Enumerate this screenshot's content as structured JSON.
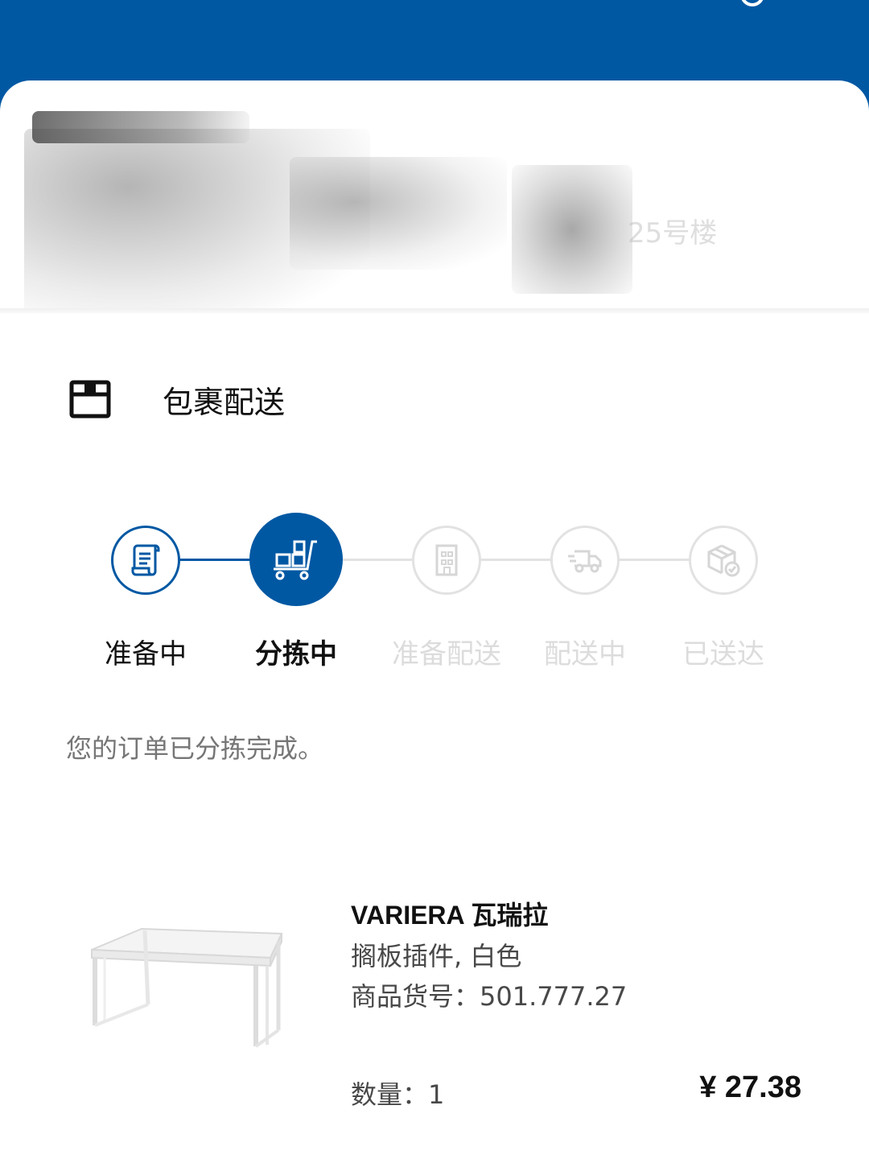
{
  "header": {
    "background_color": "#0058a3",
    "icon": "partial-icon"
  },
  "address": {
    "text": "25号楼",
    "redacted": true
  },
  "delivery": {
    "icon": "package-icon",
    "title": "包裹配送"
  },
  "progress": {
    "active_color": "#0058a3",
    "inactive_color": "#e2e2e2",
    "current_step": 2,
    "steps": [
      {
        "label": "准备中",
        "icon": "document-icon",
        "state": "completed"
      },
      {
        "label": "分拣中",
        "icon": "sorting-cart-icon",
        "state": "current"
      },
      {
        "label": "准备配送",
        "icon": "building-icon",
        "state": "pending"
      },
      {
        "label": "配送中",
        "icon": "delivery-truck-icon",
        "state": "pending"
      },
      {
        "label": "已送达",
        "icon": "delivered-box-icon",
        "state": "pending"
      }
    ]
  },
  "status_message": "您的订单已分拣完成。",
  "product": {
    "image": "shelf-insert-image",
    "name": "VARIERA 瓦瑞拉",
    "description": "搁板插件, 白色",
    "sku_line": "商品货号：501.777.27",
    "quantity_line": "数量：1",
    "price": "¥ 27.38"
  }
}
